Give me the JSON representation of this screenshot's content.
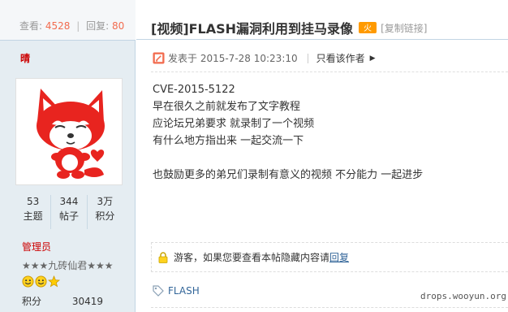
{
  "thread_stats": {
    "views_label": "查看:",
    "views": "4528",
    "replies_label": "回复:",
    "replies": "80"
  },
  "author": {
    "name": "晴",
    "stats": [
      {
        "value": "53",
        "label": "主题"
      },
      {
        "value": "344",
        "label": "帖子"
      },
      {
        "value": "3万",
        "label": "积分"
      }
    ],
    "group": "管理员",
    "rank": "★★★九砖仙君★★★",
    "medals": [
      "smiley-medal-icon",
      "smiley-medal-icon",
      "star-medal-icon"
    ],
    "score_label": "积分",
    "score_value": "30419"
  },
  "thread": {
    "title": "[视频]FLASH漏洞利用到挂马录像",
    "hot_badge": "火",
    "copy_link": "[复制链接]"
  },
  "post_meta": {
    "posted_at": "发表于 2015-7-28 10:23:10",
    "only_author": "只看该作者"
  },
  "post_body": [
    "CVE-2015-5122",
    "早在很久之前就发布了文字教程",
    "应论坛兄弟要求 就录制了一个视频",
    "有什么地方指出来 一起交流一下",
    "也鼓励更多的弟兄们录制有意义的视频 不分能力 一起进步"
  ],
  "hidden_notice": {
    "text": "游客，如果您要查看本帖隐藏内容请",
    "link": "回复"
  },
  "tags": [
    "FLASH"
  ],
  "watermark": "drops.wooyun.org",
  "colors": {
    "sidebar_bg": "#e5edf2",
    "accent_red": "#cc0000",
    "stat_orange": "#f26c4f",
    "link_blue": "#336699",
    "border_blue": "#c2d5e3"
  }
}
